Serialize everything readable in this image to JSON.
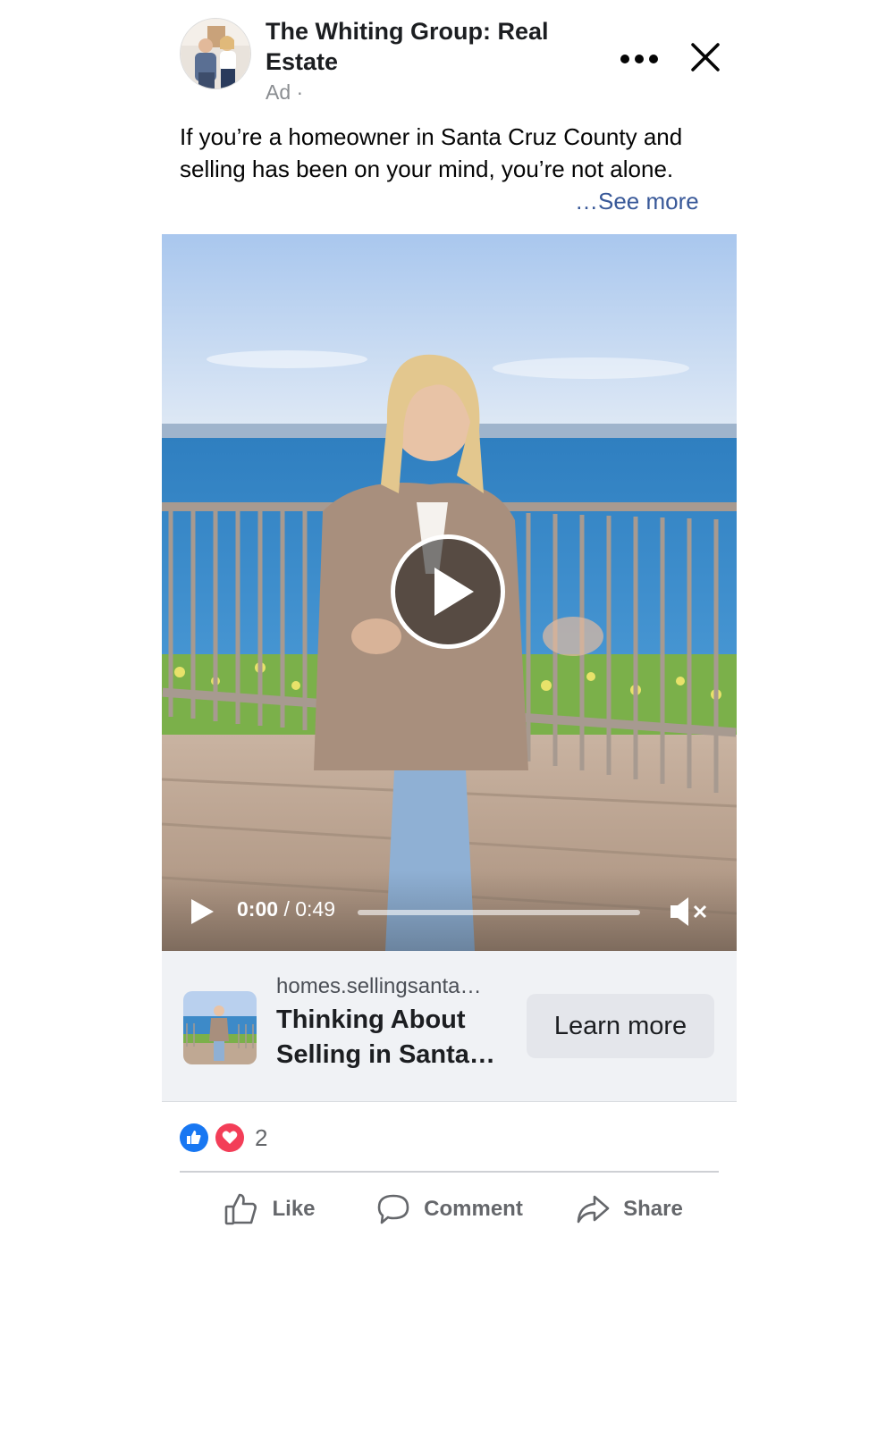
{
  "post": {
    "page_name": "The Whiting Group: Real Estate",
    "ad_label": "Ad ·",
    "more_icon": "more-horizontal-icon",
    "close_icon": "close-icon",
    "text": "If you’re a homeowner in Santa Cruz County and selling has been on your mind, you’re not alone.",
    "see_more": "…See more"
  },
  "video": {
    "current_time": "0:00",
    "duration": "/ 0:49",
    "progress": 0,
    "muted": true
  },
  "link": {
    "domain": "homes.sellingsanta…",
    "title": "Thinking About Selling in Santa…",
    "cta": "Learn more"
  },
  "reactions": {
    "count": "2",
    "types": [
      "like",
      "love"
    ]
  },
  "actions": {
    "like": "Like",
    "comment": "Comment",
    "share": "Share"
  },
  "colors": {
    "link_blue": "#385898",
    "like_blue": "#1877f2",
    "love_red": "#f33e58",
    "card_bg": "#f0f2f5"
  }
}
